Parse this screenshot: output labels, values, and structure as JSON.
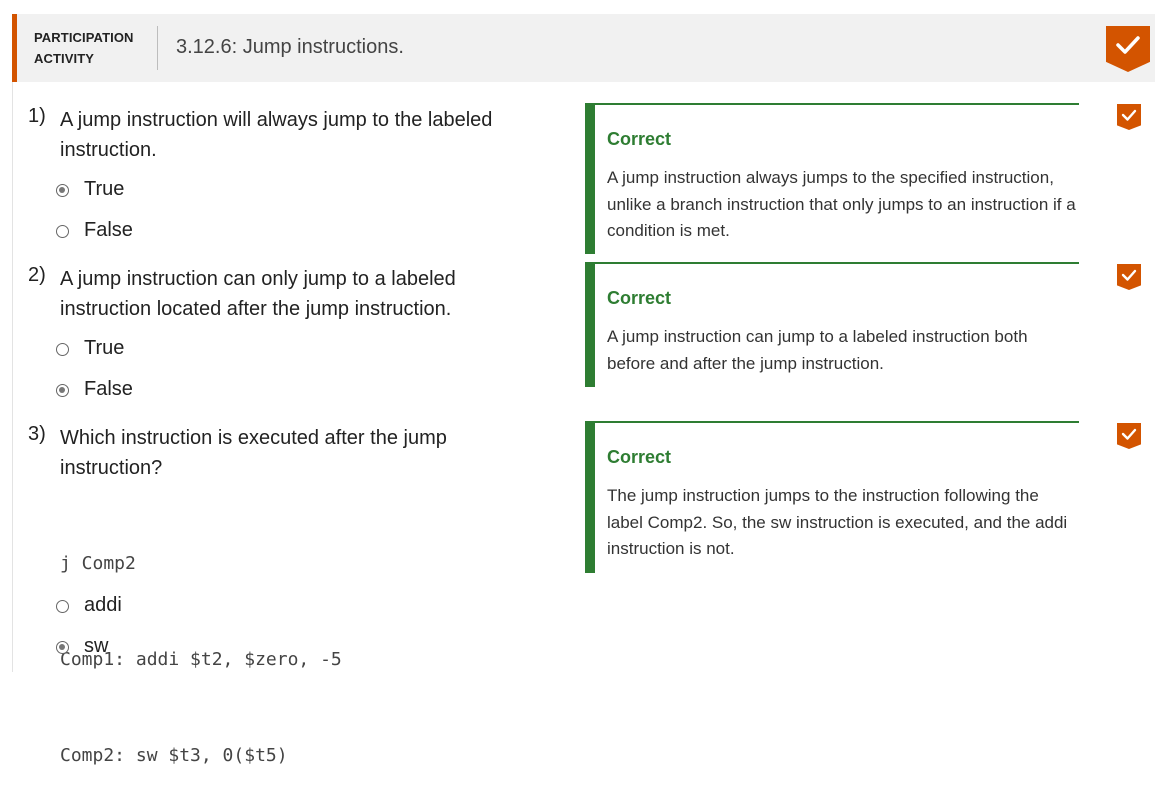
{
  "header": {
    "activity_line1": "PARTICIPATION",
    "activity_line2": "ACTIVITY",
    "title": "3.12.6: Jump instructions.",
    "completion_icon": "check-icon",
    "accent_color": "#d35400"
  },
  "questions": [
    {
      "number": "1)",
      "text": "A jump instruction will always jump to the labeled instruction.",
      "options": [
        {
          "label": "True",
          "selected": true
        },
        {
          "label": "False",
          "selected": false
        }
      ],
      "feedback": {
        "status": "Correct",
        "explanation": "A jump instruction always jumps to the specified instruction, unlike a branch instruction that only jumps to an instruction if a condition is met."
      }
    },
    {
      "number": "2)",
      "text": "A jump instruction can only jump to a labeled instruction located after the jump instruction.",
      "options": [
        {
          "label": "True",
          "selected": false
        },
        {
          "label": "False",
          "selected": true
        }
      ],
      "feedback": {
        "status": "Correct",
        "explanation": "A jump instruction can jump to a labeled instruction both before and after the jump instruction."
      }
    },
    {
      "number": "3)",
      "text": "Which instruction is executed after the jump instruction?",
      "code": [
        "j Comp2",
        "Comp1: addi $t2, $zero, -5",
        "Comp2: sw $t3, 0($t5)"
      ],
      "options": [
        {
          "label": "addi",
          "selected": false
        },
        {
          "label": "sw",
          "selected": true
        }
      ],
      "feedback": {
        "status": "Correct",
        "explanation": "The jump instruction jumps to the instruction following the label Comp2. So, the sw instruction is executed, and the addi instruction is not."
      }
    }
  ],
  "colors": {
    "correct": "#2e7d32",
    "header_bg": "#f1f1f1"
  }
}
